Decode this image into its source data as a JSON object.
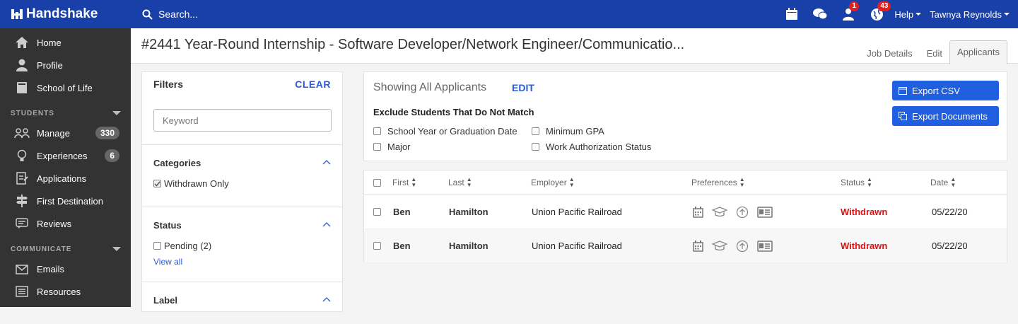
{
  "app": {
    "name": "Handshake"
  },
  "topbar": {
    "search_placeholder": "Search...",
    "notifications_count": "1",
    "network_count": "43",
    "help_label": "Help",
    "user_name": "Tawnya Reynolds"
  },
  "sidebar": {
    "items_top": [
      {
        "label": "Home",
        "icon": "home-icon"
      },
      {
        "label": "Profile",
        "icon": "person-icon"
      },
      {
        "label": "School of Life",
        "icon": "book-icon"
      }
    ],
    "students_header": "STUDENTS",
    "students_items": [
      {
        "label": "Manage",
        "count": "330",
        "icon": "users-icon"
      },
      {
        "label": "Experiences",
        "count": "6",
        "icon": "lightbulb-icon"
      },
      {
        "label": "Applications",
        "icon": "document-icon"
      },
      {
        "label": "First Destination",
        "icon": "signpost-icon"
      },
      {
        "label": "Reviews",
        "icon": "chat-icon"
      }
    ],
    "communicate_header": "COMMUNICATE",
    "communicate_items": [
      {
        "label": "Emails",
        "icon": "mail-icon"
      },
      {
        "label": "Resources",
        "icon": "newspaper-icon"
      }
    ]
  },
  "header": {
    "title": "#2441 Year-Round Internship - Software Developer/Network Engineer/Communicatio...",
    "tabs": [
      "Job Details",
      "Edit",
      "Applicants"
    ]
  },
  "filters": {
    "title": "Filters",
    "clear_label": "CLEAR",
    "keyword_placeholder": "Keyword",
    "categories_title": "Categories",
    "withdrawn_only_label": "Withdrawn Only",
    "status_title": "Status",
    "pending_label": "Pending (2)",
    "view_all_label": "View all",
    "label_title": "Label"
  },
  "showing": {
    "title": "Showing All Applicants",
    "edit_label": "EDIT",
    "exclude_title": "Exclude Students That Do Not Match",
    "options": [
      "School Year or Graduation Date",
      "Minimum GPA",
      "Major",
      "Work Authorization Status"
    ],
    "export_csv": "Export CSV",
    "export_documents": "Export Documents"
  },
  "table": {
    "columns": [
      "First",
      "Last",
      "Employer",
      "Preferences",
      "Status",
      "Date"
    ],
    "rows": [
      {
        "first": "Ben",
        "last": "Hamilton",
        "employer": "Union Pacific Railroad",
        "status": "Withdrawn",
        "date": "05/22/20"
      },
      {
        "first": "Ben",
        "last": "Hamilton",
        "employer": "Union Pacific Railroad",
        "status": "Withdrawn",
        "date": "05/22/20"
      }
    ]
  },
  "colors": {
    "brand": "#1840a8",
    "button": "#1f5fe0",
    "link": "#2a5bd7",
    "withdrawn": "#dd1111",
    "sidebar": "#333333"
  }
}
